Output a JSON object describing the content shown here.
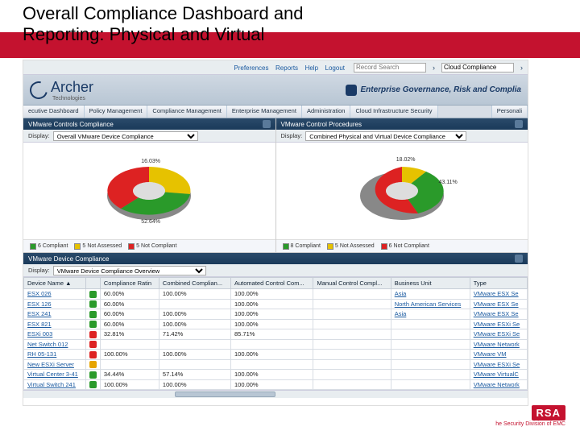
{
  "slide": {
    "title_line1": "Overall Compliance Dashboard and",
    "title_line2": "Reporting: Physical and Virtual"
  },
  "top": {
    "links": [
      "Preferences",
      "Reports",
      "Help",
      "Logout"
    ],
    "search_placeholder": "Record Search",
    "go": "›",
    "dashboard_selector": "Cloud Compliance"
  },
  "brand": {
    "name": "Archer",
    "sub": "Technologies",
    "tagline": "Enterprise Governance, Risk and Complia"
  },
  "nav": [
    "ecutive Dashboard",
    "Policy Management",
    "Compliance Management",
    "Enterprise Management",
    "Administration",
    "Cloud Infrastructure Security"
  ],
  "nav_right": "Personali",
  "panels": {
    "left": {
      "title": "VMware Controls Compliance",
      "display_label": "Display:",
      "dropdown": "Overall VMware Device Compliance"
    },
    "right": {
      "title": "VMware Control Procedures",
      "display_label": "Display:",
      "dropdown": "Combined Physical and Virtual Device Compliance"
    }
  },
  "chart_data": [
    {
      "type": "pie",
      "title": "Overall VMware Device Compliance",
      "series": [
        {
          "name": "Compliant",
          "value": 52.64,
          "color": "#2a9a2a"
        },
        {
          "name": "Not Assessed",
          "value": 31.33,
          "color": "#e6c200"
        },
        {
          "name": "Not Compliant",
          "value": 16.03,
          "color": "#d22"
        }
      ],
      "labels": {
        "top": "16.03%",
        "bottom": "52.64%"
      }
    },
    {
      "type": "pie",
      "title": "Combined Physical and Virtual Device Compliance",
      "series": [
        {
          "name": "Compliant",
          "value": 43.11,
          "color": "#2a9a2a"
        },
        {
          "name": "Not Assessed",
          "value": 18.02,
          "color": "#e6c200"
        },
        {
          "name": "Not Compliant",
          "value": 38.87,
          "color": "#d22"
        }
      ],
      "labels": {
        "top": "18.02%",
        "right": "43.11%"
      }
    }
  ],
  "legend": {
    "items": [
      "Compliant",
      "Not Assessed",
      "Not Compliant"
    ],
    "counts_left": [
      "6",
      "5",
      "5"
    ],
    "counts_right": [
      "8",
      "5",
      "6"
    ]
  },
  "table": {
    "title": "VMware Device Compliance",
    "display_label": "Display:",
    "dropdown": "VMware Device Compliance Overview",
    "headers": [
      "Device Name ▲",
      "",
      "Compliance Ratin",
      "Combined Complian...",
      "Automated Control Com...",
      "Manual Control Compl...",
      "Business Unit",
      "Type"
    ],
    "rows": [
      {
        "name": "ESX 026",
        "status": "ok",
        "rating": "60.00%",
        "combined": "100.00%",
        "auto": "100.00%",
        "manual": "",
        "bu": "Asia",
        "type": "VMware ESX Se"
      },
      {
        "name": "ESX 126",
        "status": "ok",
        "rating": "60.00%",
        "combined": "",
        "auto": "100.00%",
        "manual": "",
        "bu": "North American Services",
        "type": "VMware ESX Se"
      },
      {
        "name": "ESX 241",
        "status": "ok",
        "rating": "60.00%",
        "combined": "100.00%",
        "auto": "100.00%",
        "manual": "",
        "bu": "Asia",
        "type": "VMware ESX Se"
      },
      {
        "name": "ESX 821",
        "status": "ok",
        "rating": "60.00%",
        "combined": "100.00%",
        "auto": "100.00%",
        "manual": "",
        "bu": "",
        "type": "VMware ESXi Se"
      },
      {
        "name": "ESXi 003",
        "status": "bad",
        "rating": "32.81%",
        "combined": "71.42%",
        "auto": "85.71%",
        "manual": "",
        "bu": "",
        "type": "VMware ESXi Se"
      },
      {
        "name": "Net Switch 012",
        "status": "bad",
        "rating": "",
        "combined": "",
        "auto": "",
        "manual": "",
        "bu": "",
        "type": "VMware Network"
      },
      {
        "name": "RH 05-131",
        "status": "bad",
        "rating": "100.00%",
        "combined": "100.00%",
        "auto": "100.00%",
        "manual": "",
        "bu": "",
        "type": "VMware VM"
      },
      {
        "name": "New ESXi Server",
        "status": "warn",
        "rating": "",
        "combined": "",
        "auto": "",
        "manual": "",
        "bu": "",
        "type": "VMware ESXi Se"
      },
      {
        "name": "Virtual Center 3-41",
        "status": "ok",
        "rating": "34.44%",
        "combined": "57.14%",
        "auto": "100.00%",
        "manual": "",
        "bu": "",
        "type": "VMware VirtualC"
      },
      {
        "name": "Virtual Switch 241",
        "status": "ok",
        "rating": "100.00%",
        "combined": "100.00%",
        "auto": "100.00%",
        "manual": "",
        "bu": "",
        "type": "VMware Network"
      }
    ]
  },
  "rsa": {
    "logo": "RSA",
    "tag": "he Security Division of EMC"
  }
}
